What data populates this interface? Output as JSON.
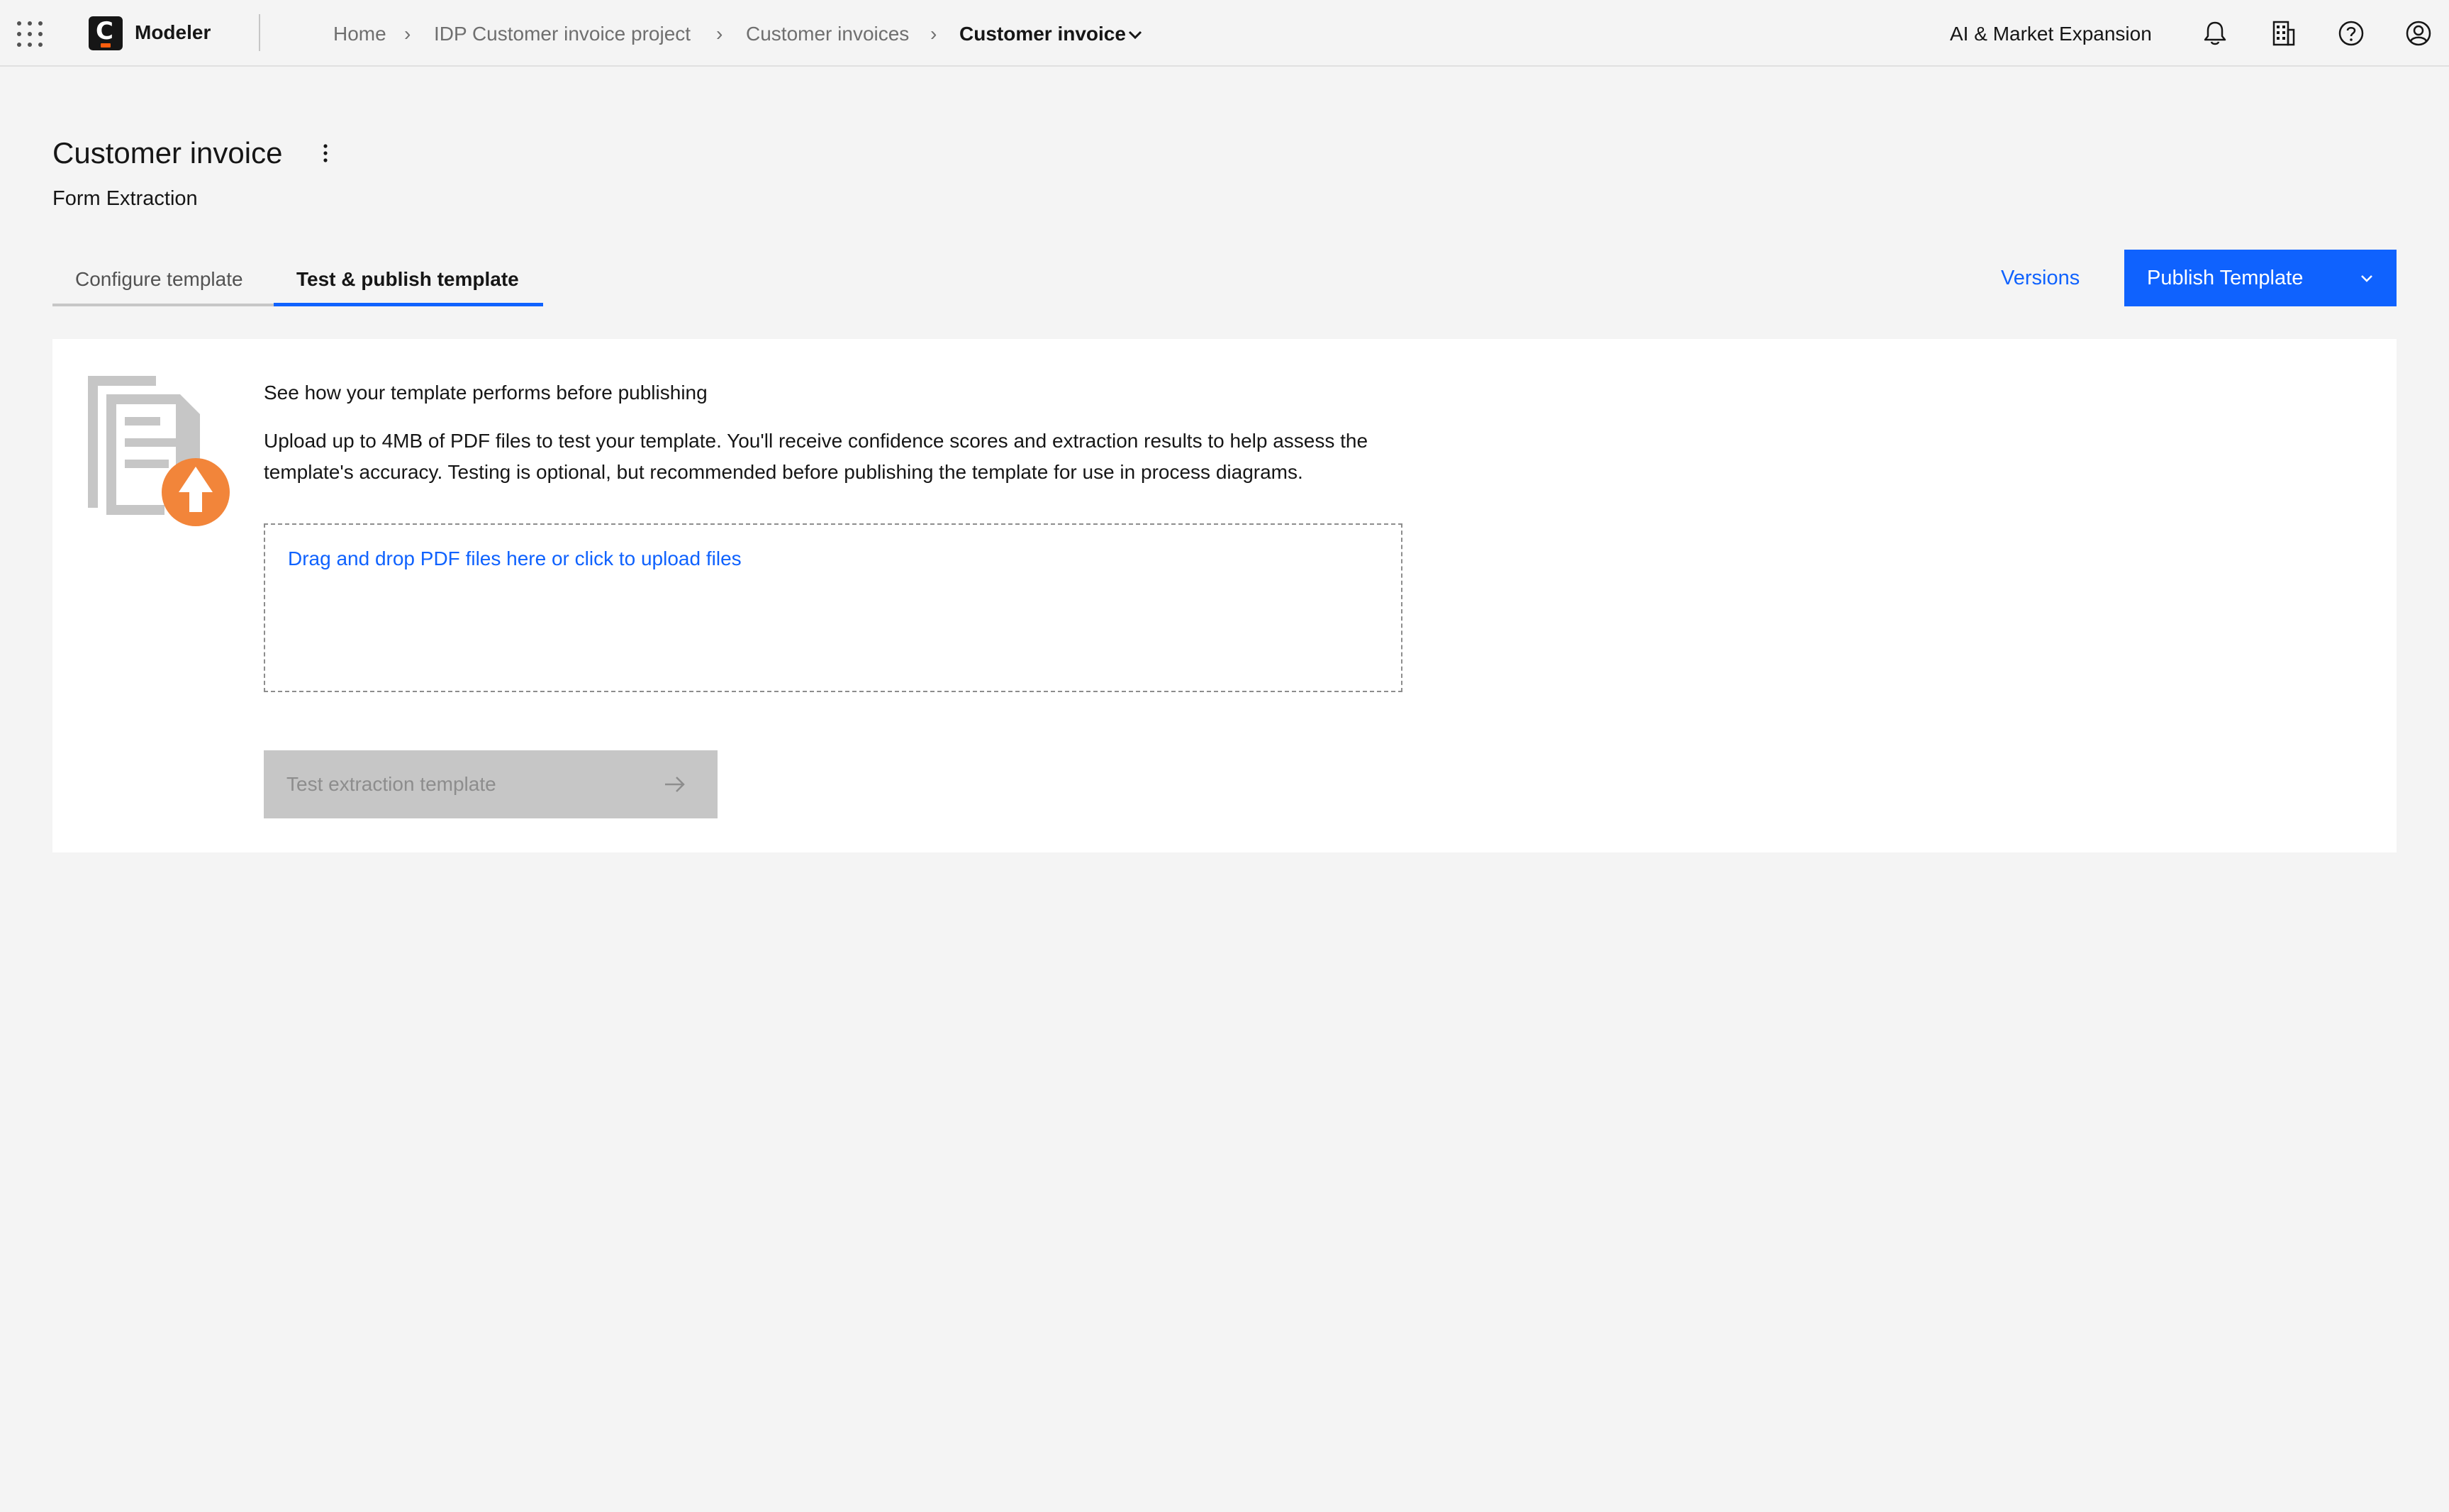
{
  "header": {
    "app_name": "Modeler",
    "logo_letter": "C",
    "breadcrumbs": [
      "Home",
      "IDP Customer invoice project",
      "Customer invoices"
    ],
    "current_page": "Customer invoice",
    "separator": "›",
    "org_name": "AI & Market Expansion",
    "icons": [
      "app-switcher-icon",
      "notification-bell-icon",
      "organization-building-icon",
      "help-icon",
      "user-profile-icon"
    ]
  },
  "page": {
    "title": "Customer invoice",
    "subtitle": "Form Extraction"
  },
  "tabs": [
    {
      "label": "Configure template",
      "active": false
    },
    {
      "label": "Test & publish template",
      "active": true
    }
  ],
  "actions": {
    "versions_label": "Versions",
    "publish_label": "Publish Template"
  },
  "test_panel": {
    "heading": "See how your template performs before publishing",
    "description": "Upload up to 4MB of PDF files to test your template. You'll receive confidence scores and extraction results to help assess the template's accuracy. Testing is optional, but recommended before publishing the template for use in process diagrams.",
    "dropzone_text": "Drag and drop PDF files here or click to upload files",
    "test_button_label": "Test extraction template",
    "test_button_disabled": true
  },
  "colors": {
    "accent": "#0f62fe",
    "upload_badge": "#f2853a",
    "background": "#f4f4f4",
    "disabled": "#c6c6c6"
  }
}
